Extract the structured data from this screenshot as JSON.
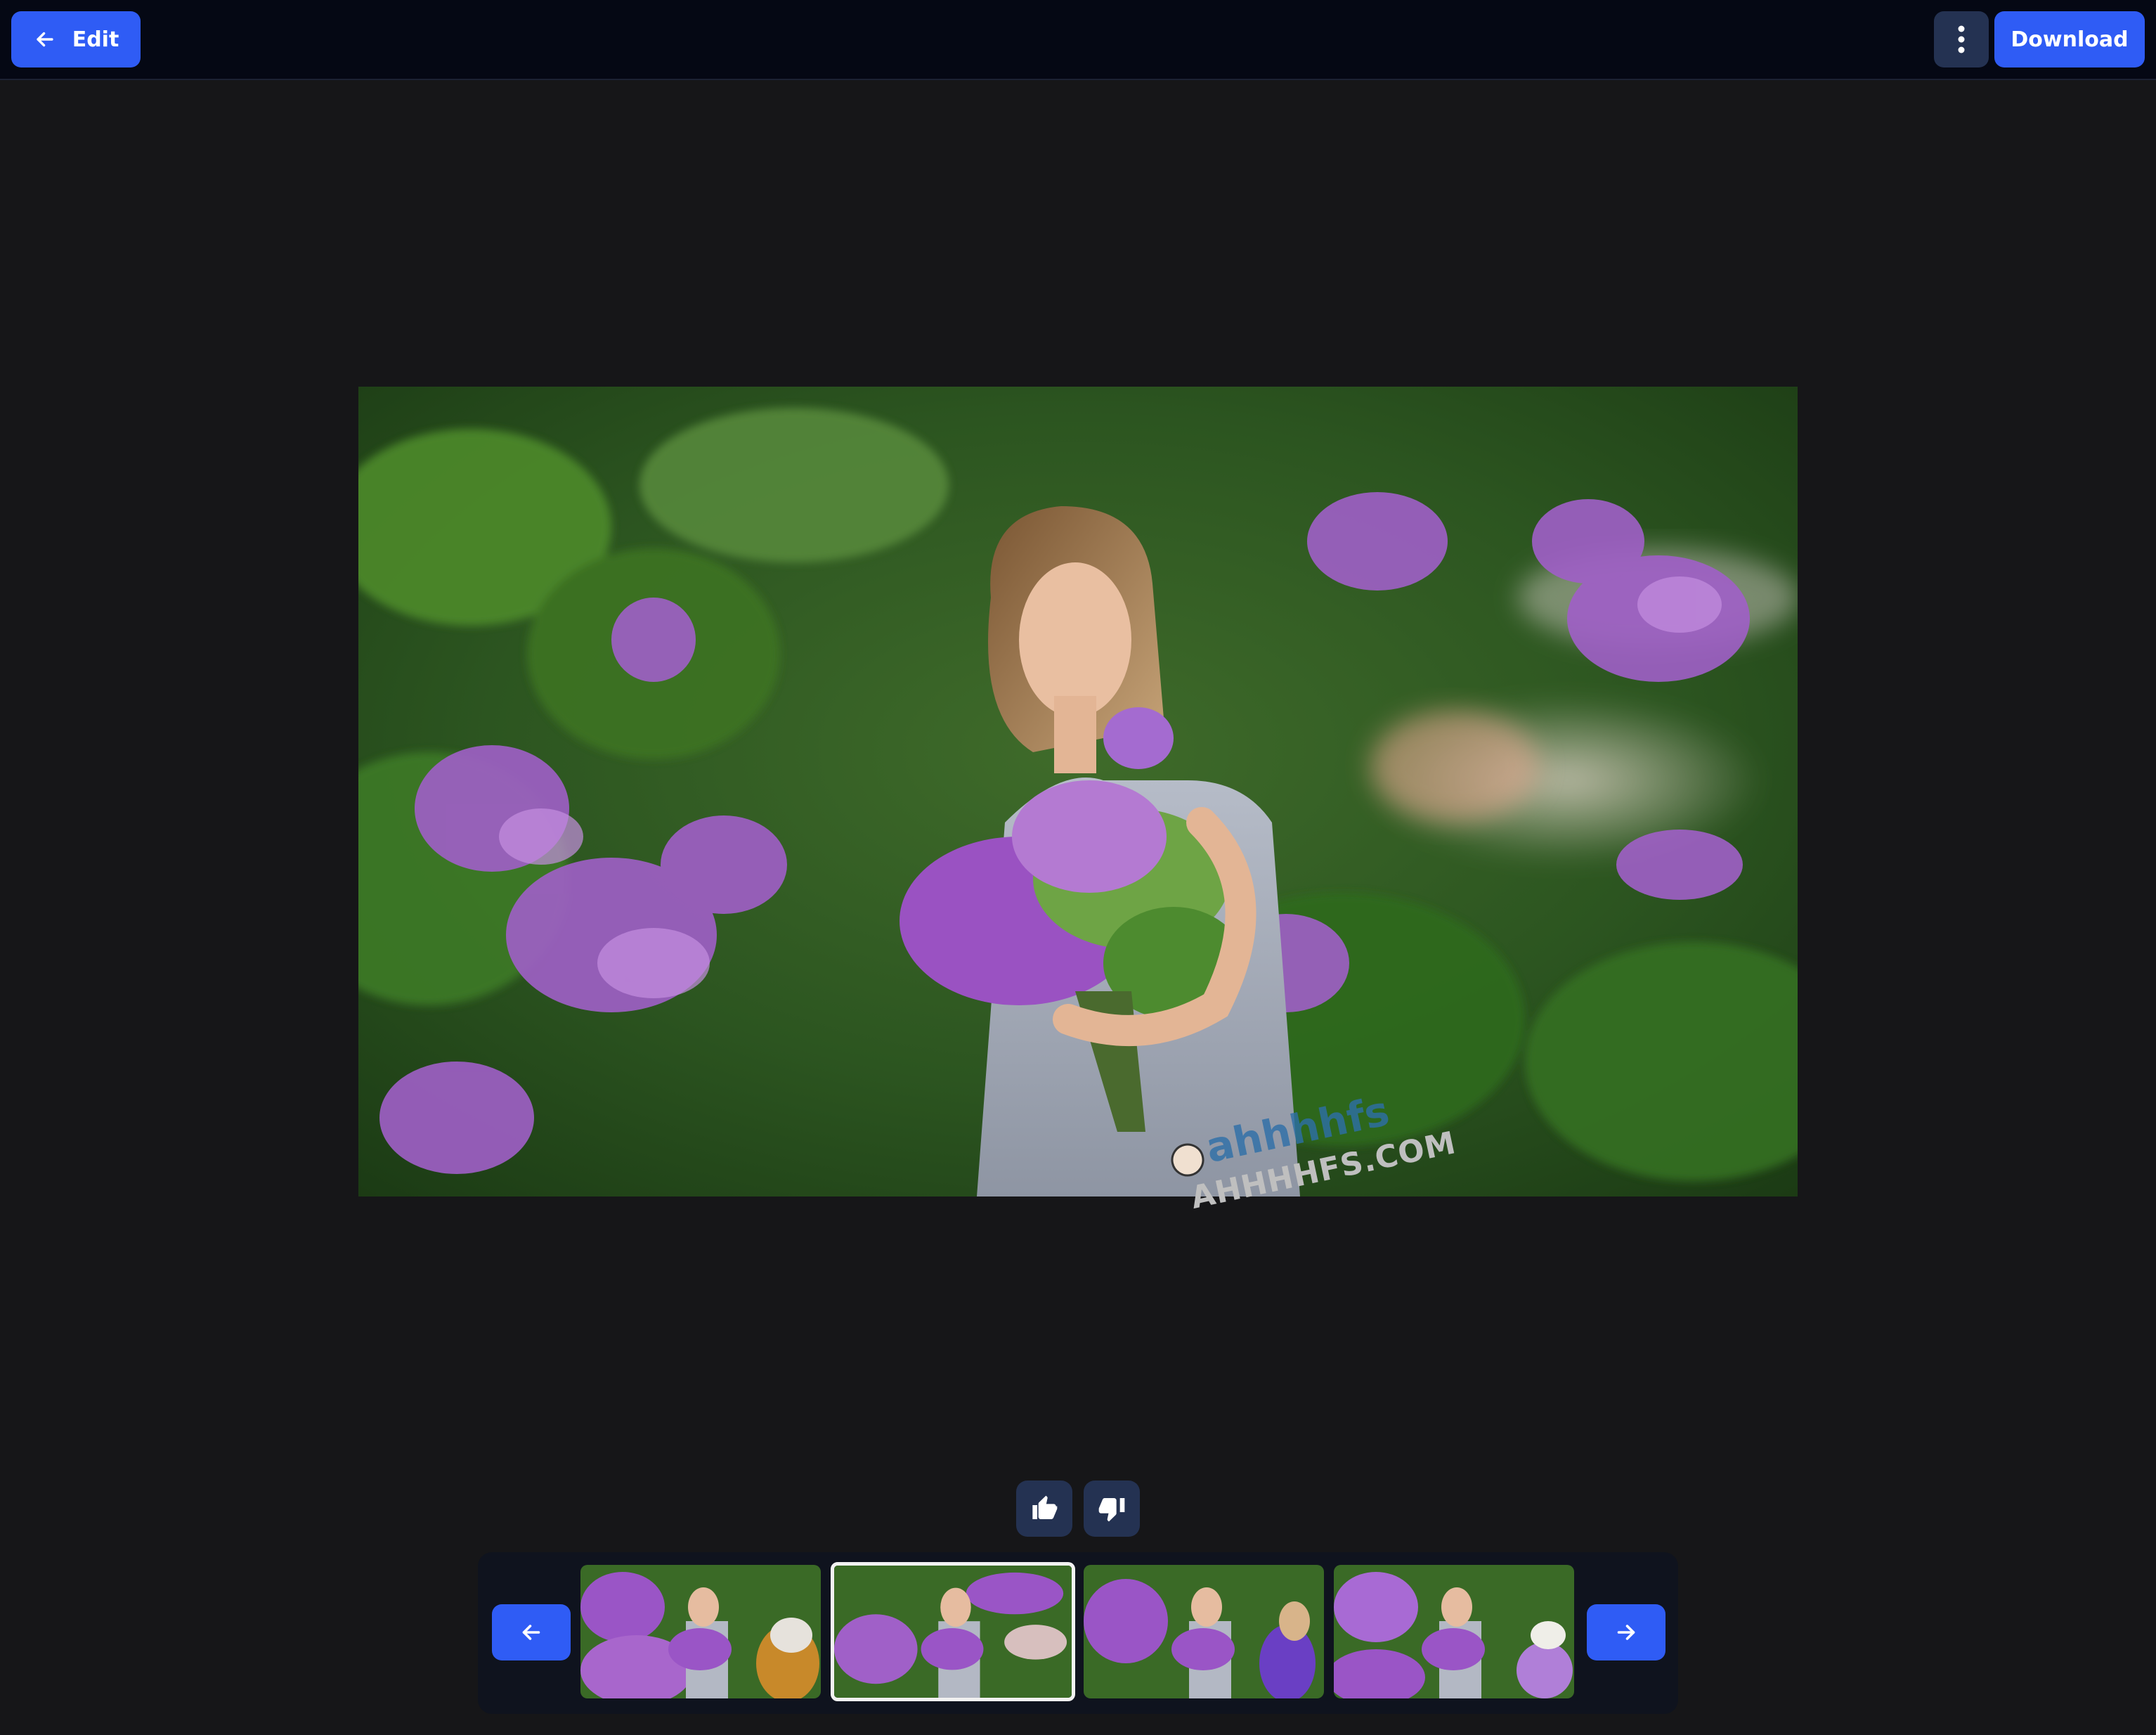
{
  "toolbar": {
    "edit_label": "Edit",
    "download_label": "Download",
    "back_icon": "arrow-left-icon",
    "menu_icon": "more-vertical-icon"
  },
  "viewer": {
    "image_description": "Woman holding a bouquet of lilac flowers in a garden",
    "watermark_logo_text": "ahhhhfs",
    "watermark_domain": "AHHHHFS.COM"
  },
  "feedback": {
    "like_icon": "thumbs-up-icon",
    "dislike_icon": "thumbs-down-icon"
  },
  "gallery": {
    "prev_icon": "arrow-left-icon",
    "next_icon": "arrow-right-icon",
    "thumbnails": [
      {
        "selected": false,
        "accent": "#c8892a"
      },
      {
        "selected": true,
        "accent": "#e9c9cf"
      },
      {
        "selected": false,
        "accent": "#6a3fc4"
      },
      {
        "selected": false,
        "accent": "#b07fd8"
      }
    ]
  },
  "colors": {
    "topbar_bg": "#050814",
    "primary": "#2f5cf5",
    "secondary_button": "#243252",
    "page_bg": "#161618"
  }
}
